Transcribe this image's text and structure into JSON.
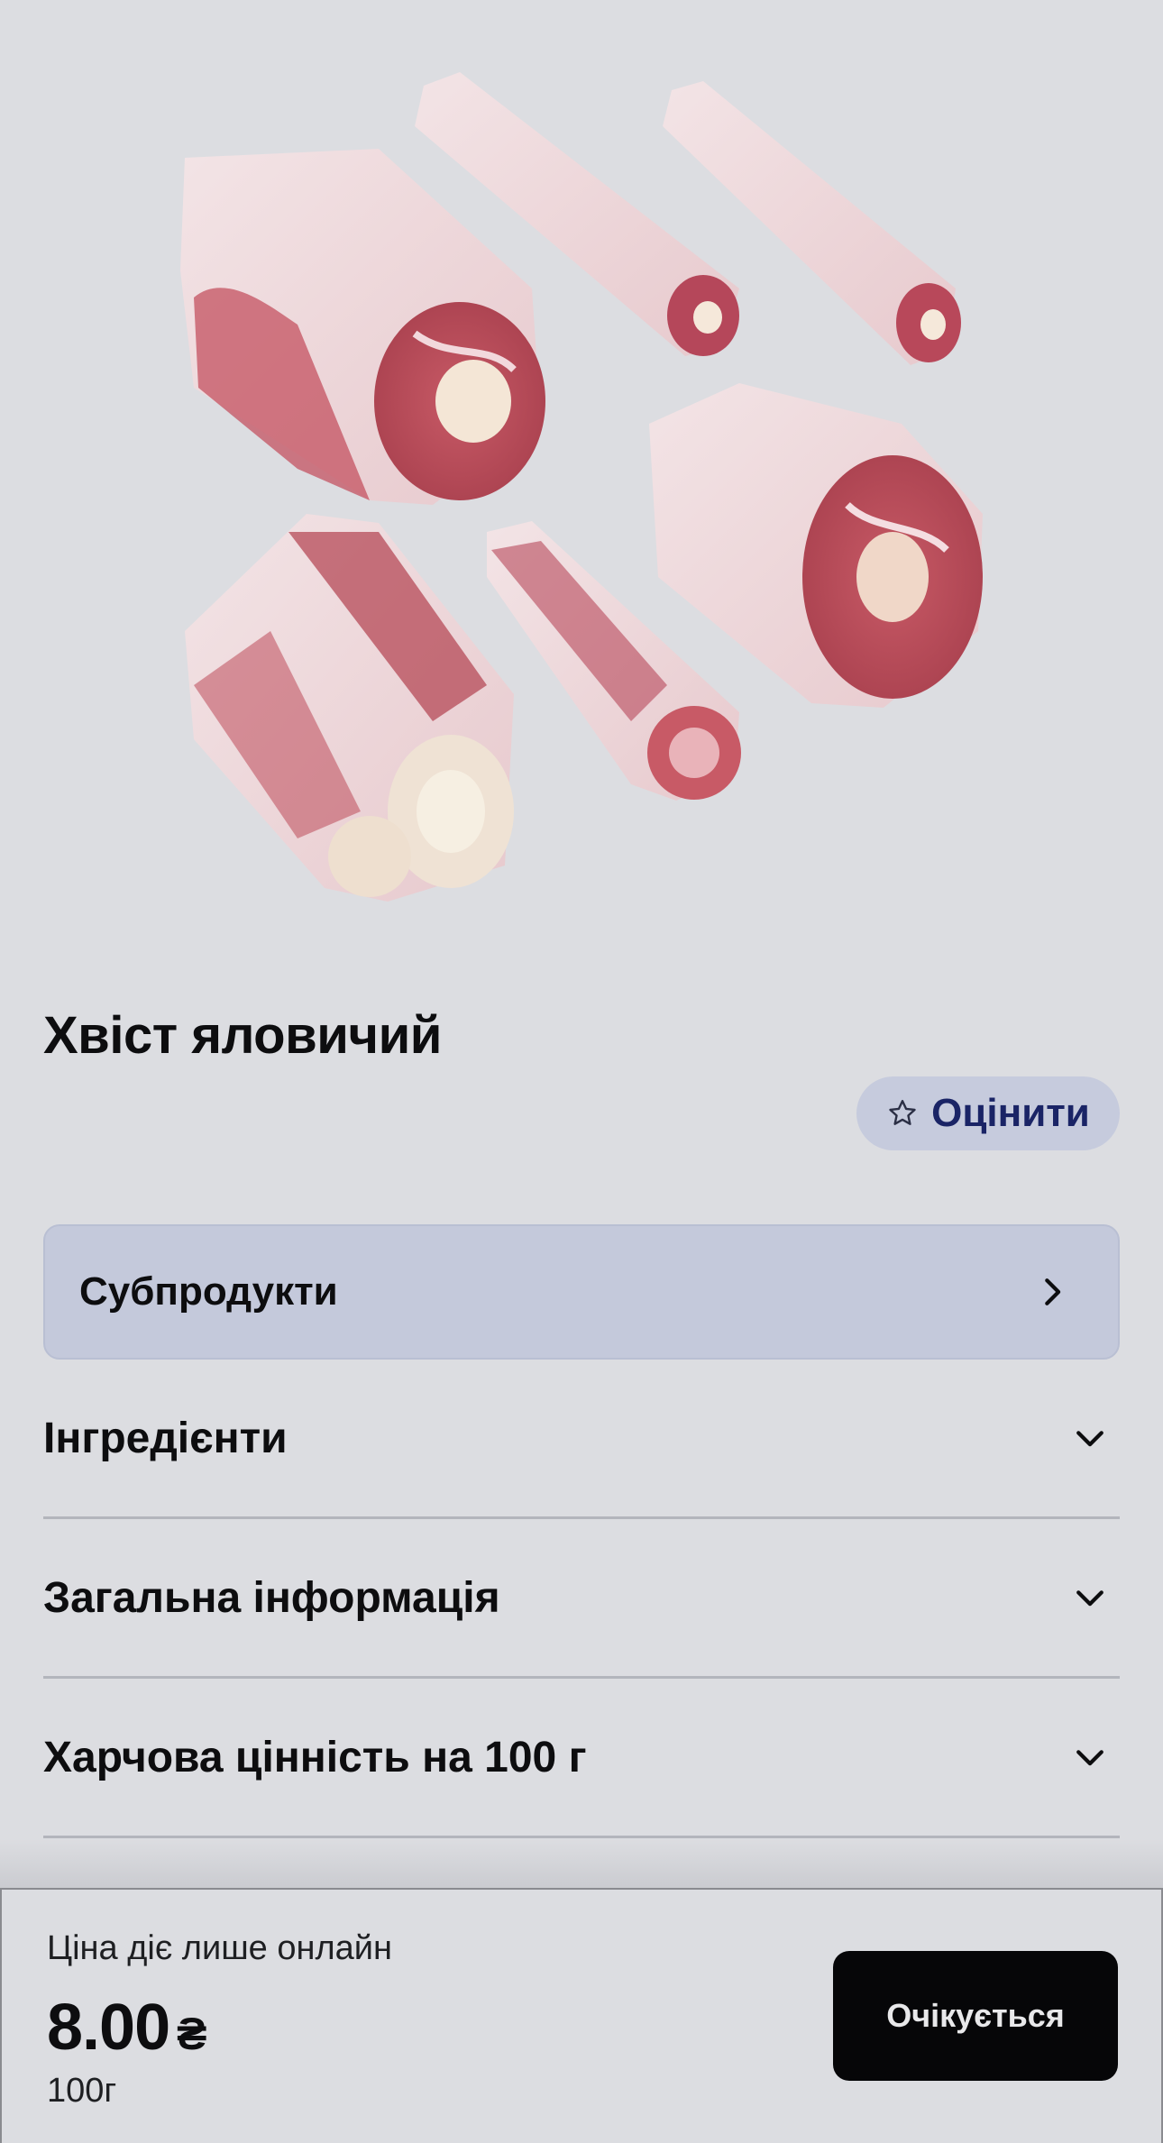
{
  "product": {
    "title": "Хвіст яловичий",
    "image_alt": "beef-oxtail-pieces"
  },
  "rate_button": {
    "label": "Оцінити",
    "icon": "star-outline-icon"
  },
  "category": {
    "label": "Субпродукти",
    "icon": "chevron-right-icon"
  },
  "accordion": [
    {
      "label": "Інгредієнти",
      "icon": "chevron-down-icon"
    },
    {
      "label": "Загальна інформація",
      "icon": "chevron-down-icon"
    },
    {
      "label": "Харчова цінність на 100 г",
      "icon": "chevron-down-icon"
    }
  ],
  "bottom_bar": {
    "note": "Ціна діє лише онлайн",
    "price": "8.00",
    "currency": "₴",
    "unit": "100г",
    "button_label": "Очікується"
  },
  "colors": {
    "background": "#dcdde1",
    "category_bg": "#c4c9db",
    "rate_bg": "#c6cbdd",
    "rate_text": "#1a2466",
    "button_bg": "#060608"
  }
}
